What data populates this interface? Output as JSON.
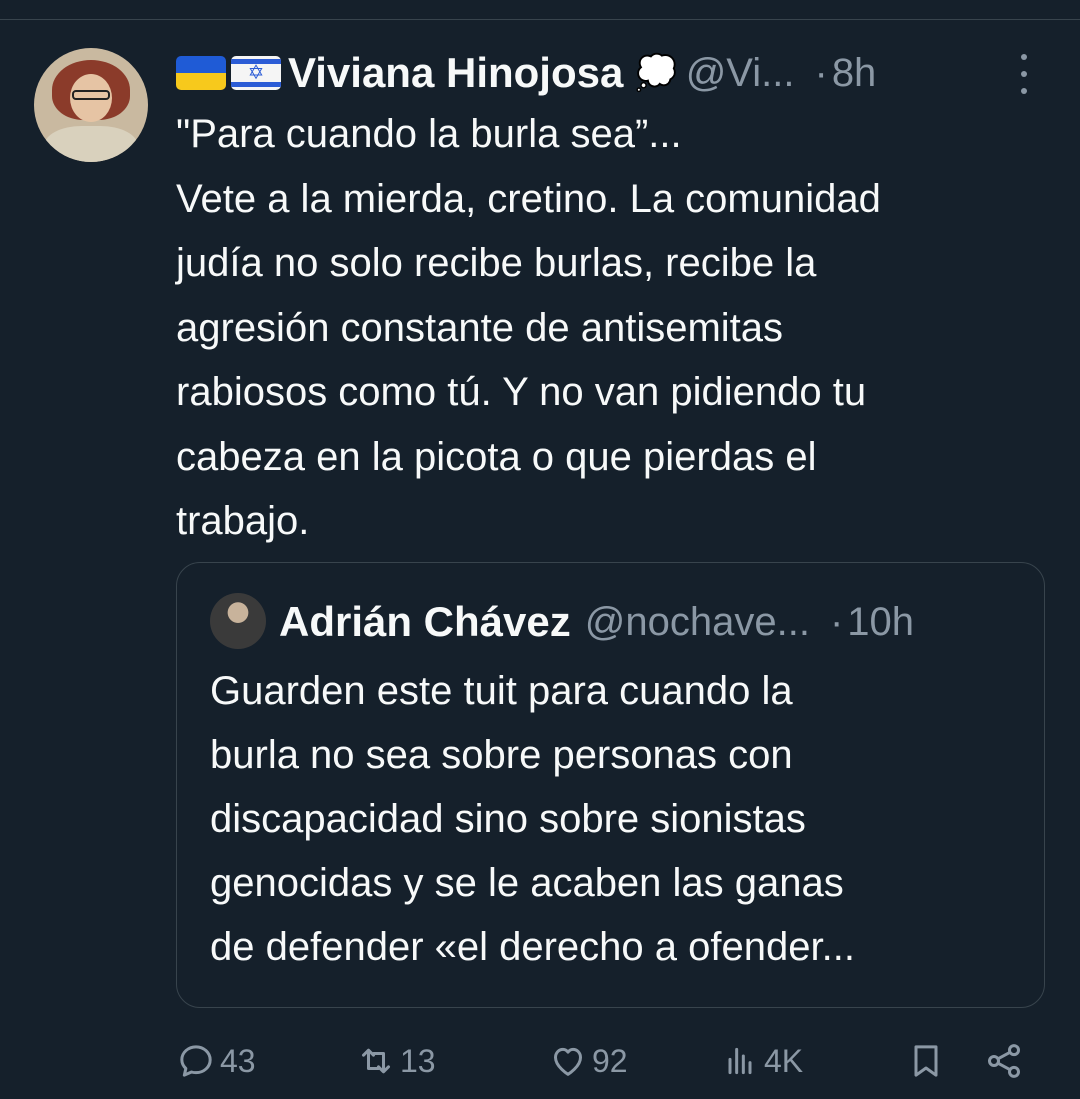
{
  "tweet": {
    "author": {
      "flags": [
        "ukraine-flag",
        "israel-flag"
      ],
      "display_name": "Viviana Hinojosa",
      "badge_icon": "thought-balloon-icon",
      "handle": "@Vi...",
      "time": "8h"
    },
    "text_lines": [
      "\"Para cuando la burla sea”...",
      "Vete a la mierda, cretino. La comunidad",
      "judía no solo recibe burlas, recibe la",
      "agresión constante de antisemitas",
      "rabiosos como tú. Y no van pidiendo tu",
      "cabeza en la picota o que pierdas el",
      "trabajo."
    ],
    "quote": {
      "display_name": "Adrián Chávez",
      "handle": "@nochave...",
      "time": "10h",
      "text_lines": [
        "Guarden este tuit para cuando la",
        "burla no sea sobre personas con",
        "discapacidad sino sobre sionistas",
        "genocidas y se le acaben las ganas",
        "de defender «el derecho a ofender..."
      ]
    },
    "actions": {
      "replies": "43",
      "retweets": "13",
      "likes": "92",
      "views": "4K"
    },
    "dot_separator": "·"
  }
}
